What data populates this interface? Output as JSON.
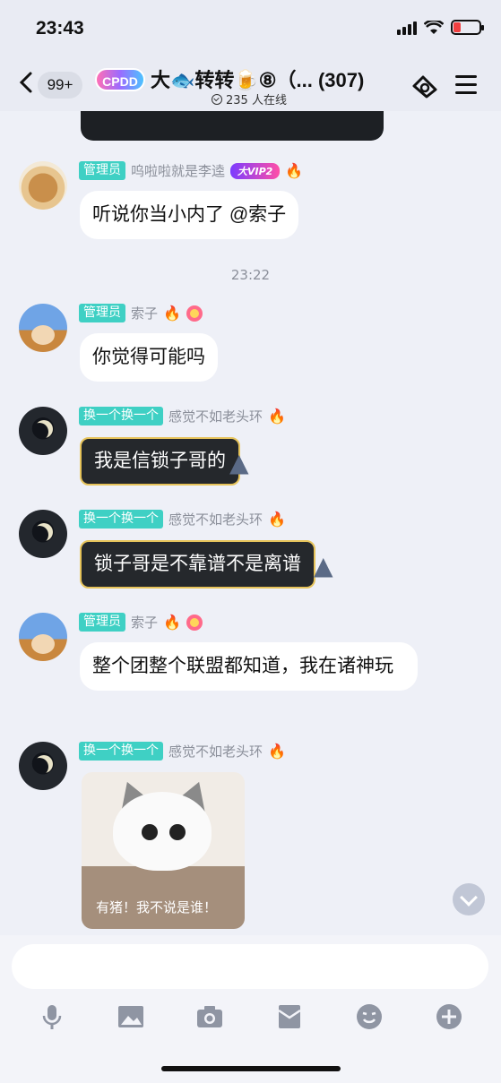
{
  "status_bar": {
    "time": "23:43"
  },
  "header": {
    "unread_count": "99+",
    "group_logo_text": "CPDD",
    "group_title": "大🐟转转🍺⑧（... (307)",
    "online_count": "235 人在线"
  },
  "messages": [
    {
      "role": "管理员",
      "nickname": "呜啦啦就是李逵",
      "vip_badge": "大VIP2",
      "text": "听说你当小内了 @索子"
    },
    {
      "timestamp": "23:22"
    },
    {
      "role": "管理员",
      "nickname": "索子",
      "text": "你觉得可能吗"
    },
    {
      "role": "换一个换一个",
      "nickname": "感觉不如老头环",
      "text": "我是信锁子哥的"
    },
    {
      "role": "换一个换一个",
      "nickname": "感觉不如老头环",
      "text": "锁子哥是不靠谱不是离谱"
    },
    {
      "role": "管理员",
      "nickname": "索子",
      "text": "整个团整个联盟都知道，我在诸神玩"
    },
    {
      "role": "换一个换一个",
      "nickname": "感觉不如老头环",
      "sticker_caption": "有猪！我不说是谁！"
    }
  ],
  "input": {
    "placeholder": ""
  },
  "toolbar": {
    "icons": [
      "microphone-icon",
      "image-icon",
      "camera-icon",
      "red-packet-icon",
      "emoji-icon",
      "plus-icon"
    ]
  },
  "colors": {
    "admin_tag": "#3fd0c4",
    "dark_bubble": "#25282c",
    "background": "#eef0f7"
  }
}
